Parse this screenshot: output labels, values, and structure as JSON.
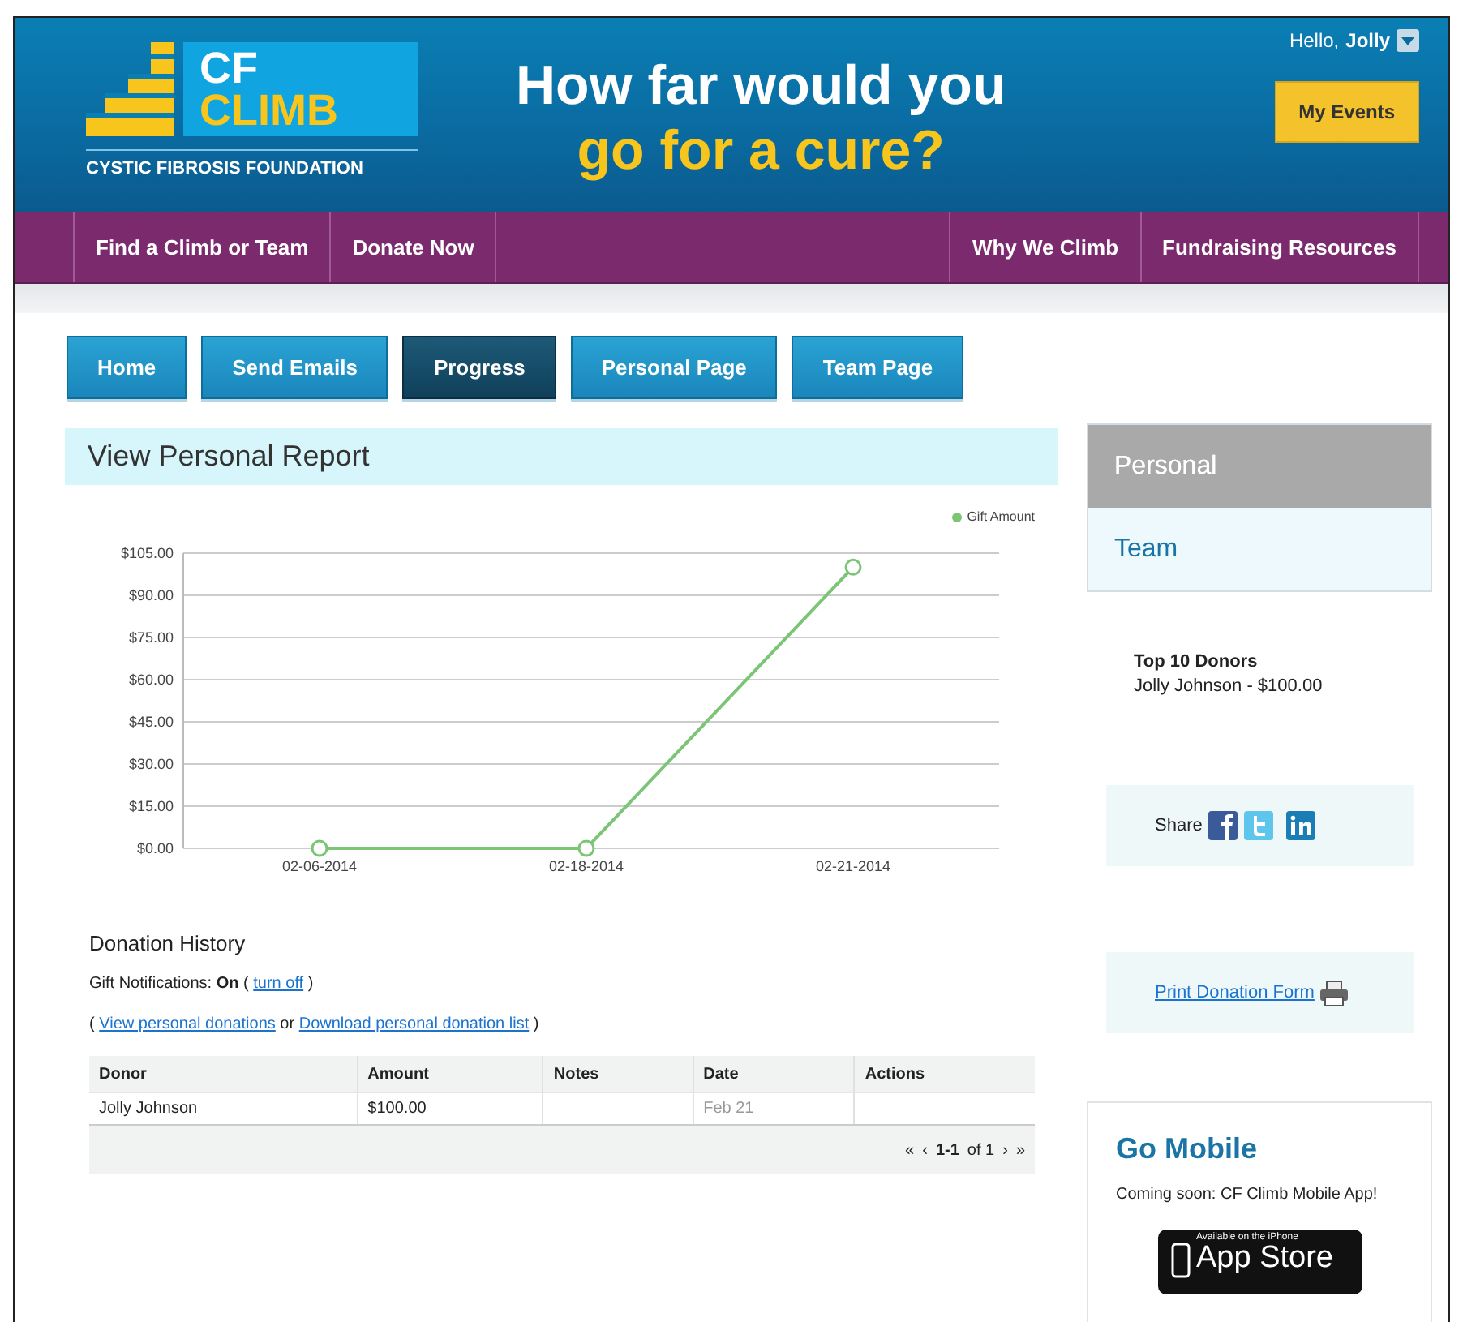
{
  "header": {
    "logo": {
      "line_1": "CF",
      "line_2": "CLIMB",
      "tagline": "CYSTIC FIBROSIS FOUNDATION"
    },
    "headline": {
      "line_1": "How far would you",
      "line_2": "go for a cure?"
    },
    "greeting": "Hello,",
    "user": "Jolly",
    "my_events": "My Events"
  },
  "nav": {
    "left_items": [
      {
        "label": "Find a Climb or Team"
      },
      {
        "label": "Donate Now"
      }
    ],
    "right_items": [
      {
        "label": "Why We Climb"
      },
      {
        "label": "Fundraising Resources"
      }
    ]
  },
  "tabs": [
    {
      "label": "Home",
      "selected": false
    },
    {
      "label": "Send Emails",
      "selected": false
    },
    {
      "label": "Progress",
      "selected": true
    },
    {
      "label": "Personal Page",
      "selected": false
    },
    {
      "label": "Team Page",
      "selected": false
    }
  ],
  "report": {
    "title": "View Personal Report",
    "chart_data": {
      "type": "line",
      "categories": [
        "02-06-2014",
        "02-18-2014",
        "02-21-2014"
      ],
      "series": [
        {
          "name": "Gift Amount",
          "color": "#7cc576",
          "values": [
            0,
            0,
            100
          ],
          "marker": true
        }
      ],
      "ylim": [
        0,
        105
      ],
      "grid": true,
      "yticks": [
        {
          "value": 0,
          "label": "$0.00"
        },
        {
          "value": 15,
          "label": "$15.00"
        },
        {
          "value": 30,
          "label": "$30.00"
        },
        {
          "value": 45,
          "label": "$45.00"
        },
        {
          "value": 60,
          "label": "$60.00"
        },
        {
          "value": 75,
          "label": "$75.00"
        },
        {
          "value": 90,
          "label": "$90.00"
        },
        {
          "value": 105,
          "label": "$105.00"
        }
      ]
    }
  },
  "donation_history": {
    "title": "Donation History",
    "notifications": {
      "before": "Gift Notifications: **On** (",
      "link": "turn off",
      "after": ")"
    },
    "links_line": {
      "before": "(",
      "link_1": "View personal donations",
      "between": "or",
      "link_2": "Download personal donation list",
      "after": ")"
    },
    "table": {
      "columns": [
        "Donor",
        "Amount",
        "Notes",
        "Date",
        "Actions"
      ],
      "rows": [
        {
          "donor": "Jolly Johnson",
          "amount": "$100.00",
          "date": "Feb 21"
        }
      ]
    },
    "pagination": {
      "first": "«",
      "prev": "‹",
      "range": "1-1",
      "of": "of 1",
      "next": "›",
      "last": "»"
    }
  },
  "sidebar": {
    "views": [
      {
        "label": "Personal",
        "selected": true
      },
      {
        "label": "Team",
        "selected": false
      }
    ],
    "top_donors": {
      "title": "Top 10 Donors",
      "entries": [
        "Jolly Johnson - $100.00"
      ]
    },
    "share": {
      "label": "Share"
    },
    "print": {
      "link": "Print Donation Form"
    },
    "mobile": {
      "title": "Go Mobile",
      "text": "Coming soon: CF Climb Mobile App!",
      "badge": {
        "line_1": "Available on the iPhone",
        "line_2": "App Store"
      }
    }
  }
}
